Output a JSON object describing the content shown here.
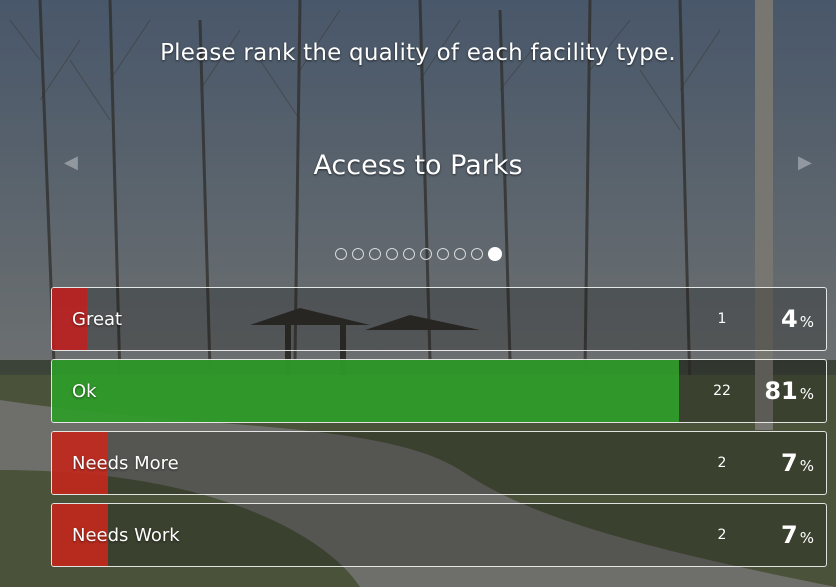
{
  "survey": {
    "question": "Please rank the quality of each facility type.",
    "subtitle": "Access to Parks",
    "prev_arrow": "◀",
    "next_arrow": "▶",
    "page_count": 10,
    "active_page": 10
  },
  "options": [
    {
      "label": "Great",
      "count": "1",
      "percent": "4",
      "percent_symbol": "%",
      "fill_fraction": 0.045,
      "color": "#c21f1f"
    },
    {
      "label": "Ok",
      "count": "22",
      "percent": "81",
      "percent_symbol": "%",
      "fill_fraction": 0.81,
      "color": "#2fa32a"
    },
    {
      "label": "Needs More",
      "count": "2",
      "percent": "7",
      "percent_symbol": "%",
      "fill_fraction": 0.072,
      "color": "#c8281c"
    },
    {
      "label": "Needs Work",
      "count": "2",
      "percent": "7",
      "percent_symbol": "%",
      "fill_fraction": 0.072,
      "color": "#c8281c"
    }
  ]
}
